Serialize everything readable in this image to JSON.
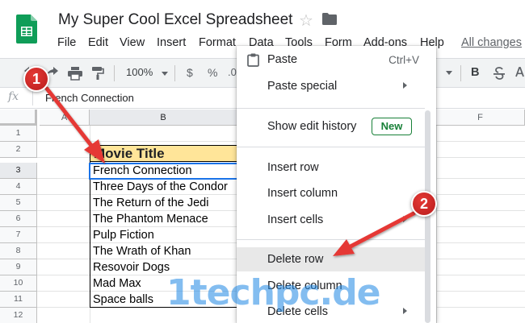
{
  "header": {
    "title": "My Super Cool Excel Spreadsheet",
    "menu": [
      "File",
      "Edit",
      "View",
      "Insert",
      "Format",
      "Data",
      "Tools",
      "Form",
      "Add-ons",
      "Help"
    ],
    "all_changes": "All changes"
  },
  "toolbar": {
    "zoom": "100%",
    "currency": "$",
    "percent": "%",
    "decimal": ".0",
    "bold": "B"
  },
  "formula_bar": {
    "fx": "fx",
    "value": "French Connection"
  },
  "grid": {
    "columns": [
      "A",
      "B",
      "F"
    ],
    "rows": [
      "1",
      "2",
      "3",
      "4",
      "5",
      "6",
      "7",
      "8",
      "9",
      "10",
      "11",
      "12"
    ],
    "header_cell": "Movie Title",
    "movies": [
      "French Connection",
      "Three Days of the Condor",
      "The Return of the Jedi",
      "The Phantom Menace",
      "Pulp Fiction",
      "The Wrath of Khan",
      "Resovoir Dogs",
      "Mad Max",
      "Space balls"
    ]
  },
  "context_menu": {
    "paste": "Paste",
    "paste_shortcut": "Ctrl+V",
    "paste_special": "Paste special",
    "show_edit_history": "Show edit history",
    "new_badge": "New",
    "insert_row": "Insert row",
    "insert_column": "Insert column",
    "insert_cells": "Insert cells",
    "delete_row": "Delete row",
    "delete_column": "Delete column",
    "delete_cells": "Delete cells"
  },
  "annotations": {
    "step1": "1",
    "step2": "2",
    "arrow_color": "#e53935",
    "watermark": "1techpc.de"
  },
  "colors": {
    "sheets_green": "#0f9d58",
    "header_fill": "#ffe599",
    "selection_blue": "#1a73e8",
    "new_badge_green": "#188038"
  }
}
